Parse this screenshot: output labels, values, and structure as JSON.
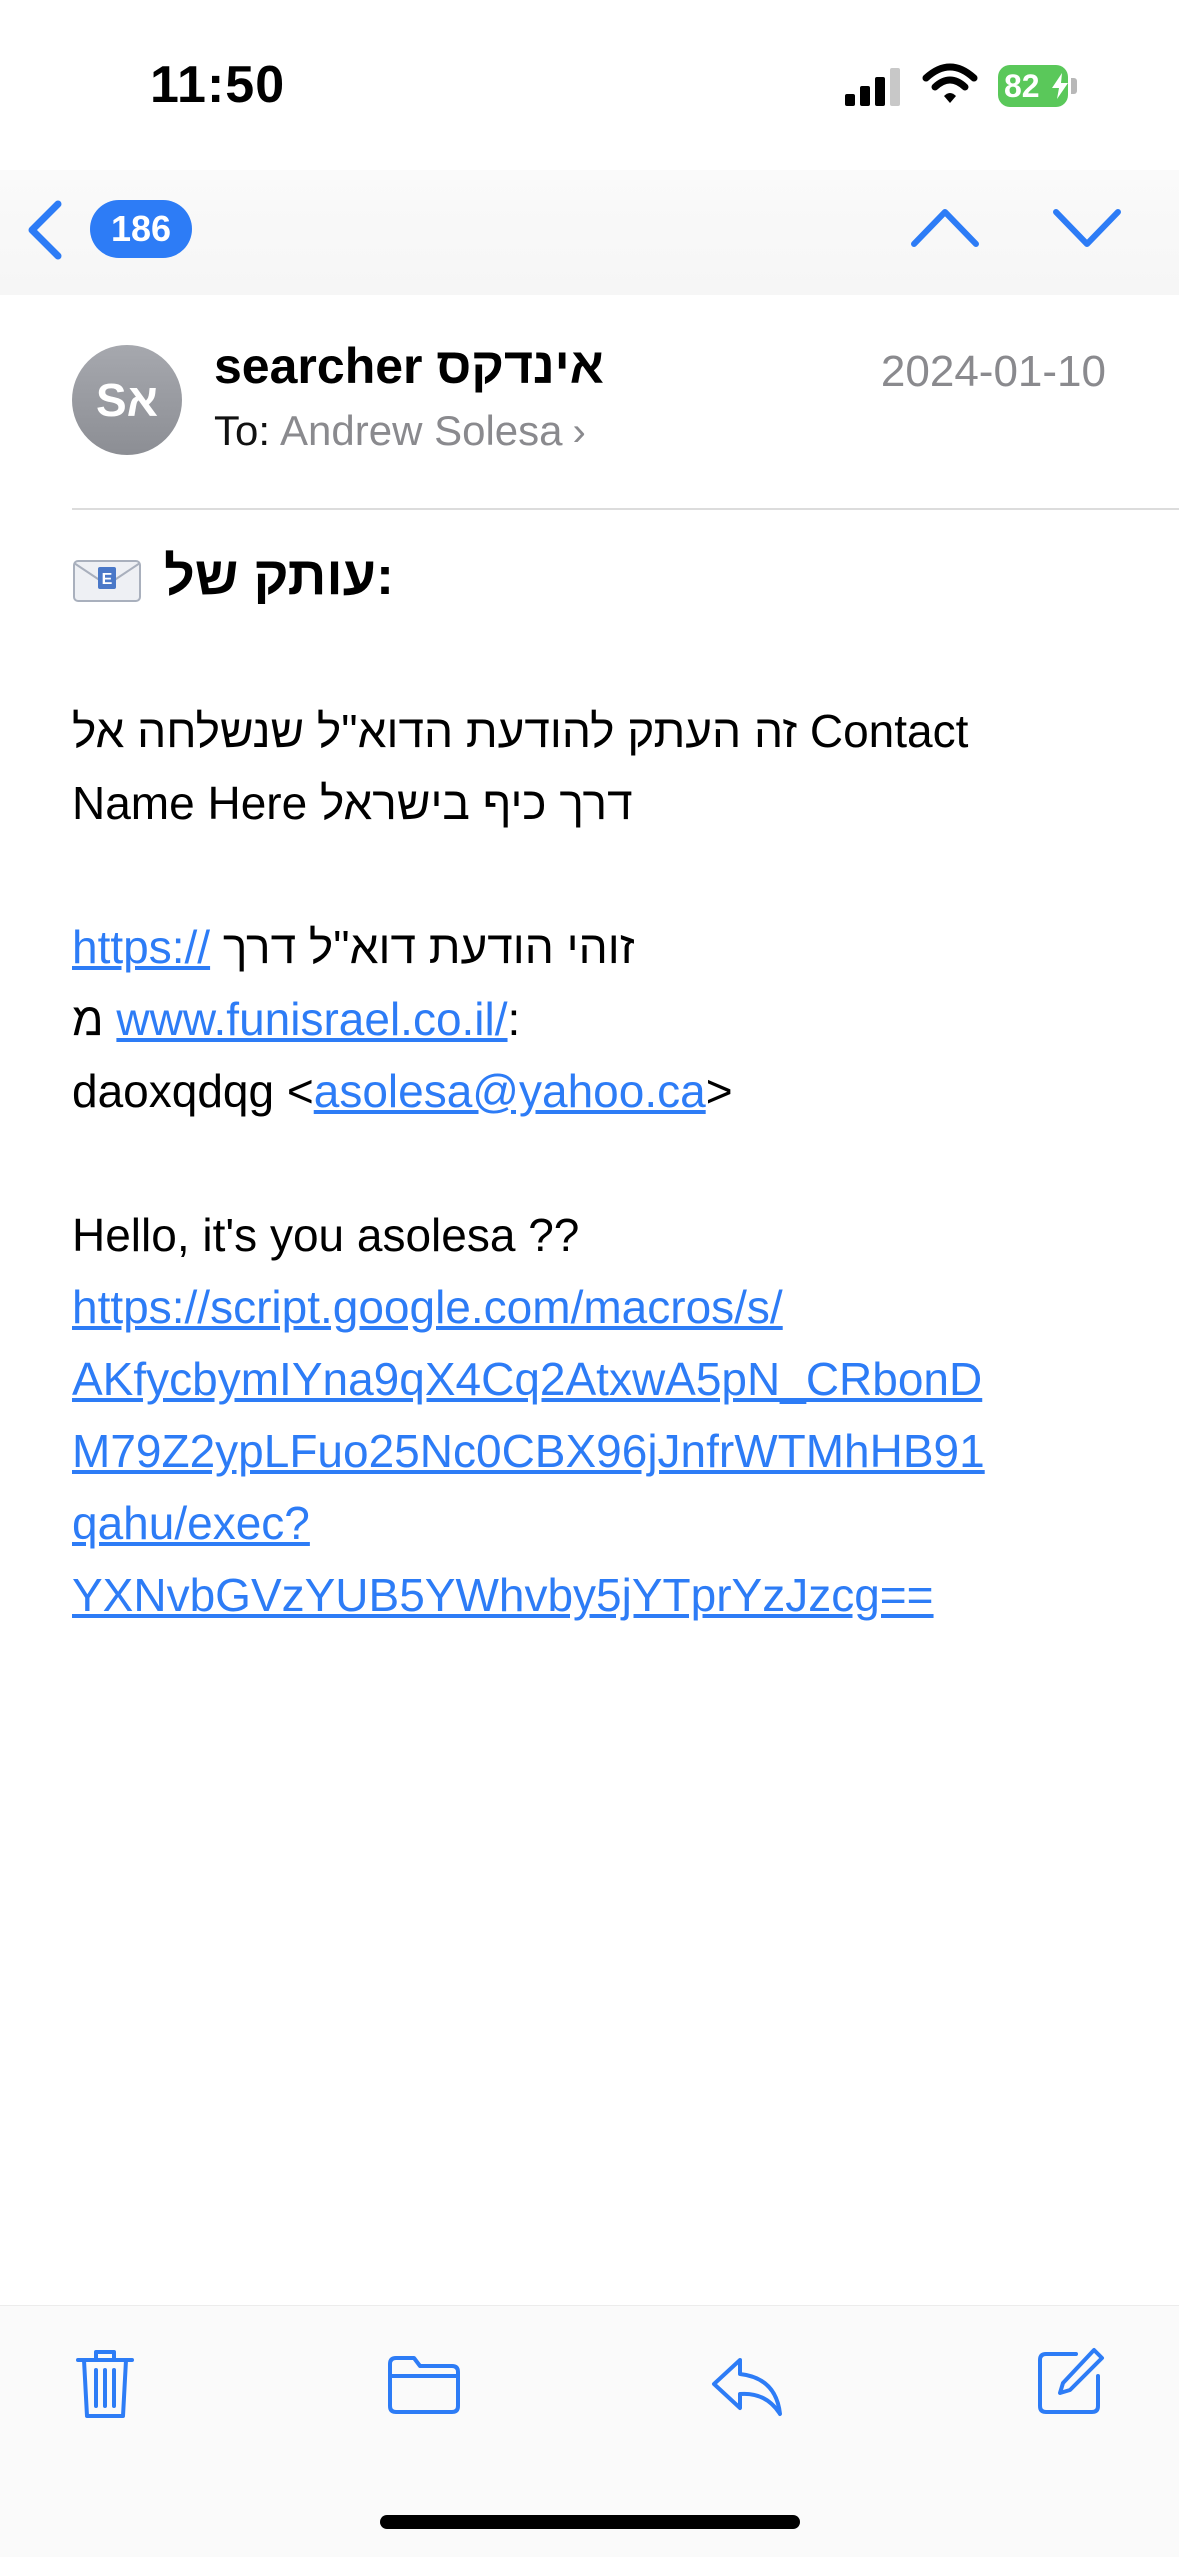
{
  "status_bar": {
    "time": "11:50",
    "battery_percent": "82",
    "icons": [
      "cellular-signal-icon",
      "wifi-icon",
      "battery-charging-icon"
    ]
  },
  "nav": {
    "unread_count": "186",
    "icons": [
      "chevron-left-icon",
      "chevron-up-icon",
      "chevron-down-icon"
    ],
    "accent_color": "#2d7cf6"
  },
  "message": {
    "avatar_initials": "Sא",
    "sender": "searcher אינדקס",
    "to_label": "To:",
    "to_name": "Andrew Solesa",
    "date": "2024-01-10",
    "subject": "עותק של:"
  },
  "body": {
    "para1_line1": "זה העתק להודעת הדוא\"ל שנשלחה אל Contact",
    "para1_line2": "Name Here דרך כיף בישראל",
    "para2_line1_link": "https://",
    "para2_line1_text": "זוהי הודעת דוא\"ל דרך",
    "para2_line2_text": "מ",
    "para2_line2_link": "www.funisrael.co.il/",
    "para2_line2_tail": ":",
    "para2_line3_text": "daoxqdqg <",
    "para2_line3_link": "asolesa@yahoo.ca",
    "para2_line3_tail": ">",
    "para3_text": "Hello, it's you asolesa ??",
    "para3_link_lines": [
      "https://script.google.com/macros/s/",
      "AKfycbymIYna9qX4Cq2AtxwA5pN_CRbonD",
      "M79Z2ypLFuo25Nc0CBX96jJnfrWTMhHB91",
      "qahu/exec?",
      "YXNvbGVzYUB5YWhvby5jYTprYzJzcg=="
    ]
  },
  "toolbar": {
    "icons": [
      "trash-icon",
      "folder-icon",
      "reply-icon",
      "compose-icon"
    ]
  }
}
